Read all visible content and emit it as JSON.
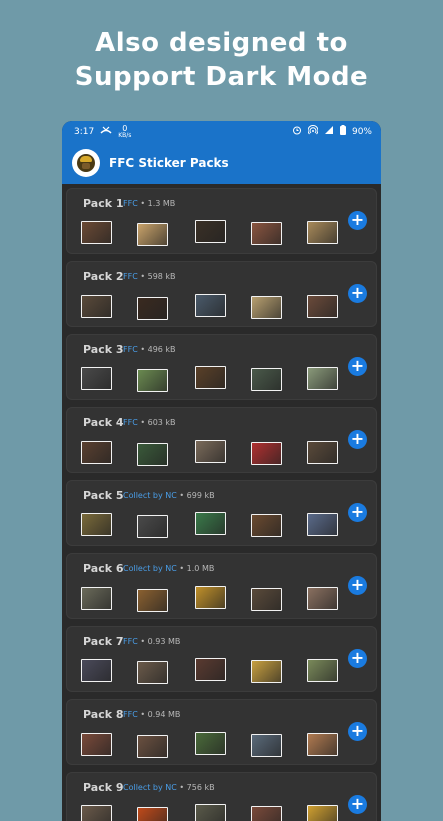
{
  "promo": {
    "line1": "Also designed to",
    "line2": "Support Dark Mode"
  },
  "status": {
    "time": "3:17",
    "speed_top": "0",
    "speed_unit": "KB/s",
    "battery": "90%"
  },
  "app": {
    "title": "FFC Sticker Packs"
  },
  "packs": [
    {
      "name": "Pack 1",
      "publisher": "FFC",
      "size": "1.3 MB"
    },
    {
      "name": "Pack 2",
      "publisher": "FFC",
      "size": "598 kB"
    },
    {
      "name": "Pack 3",
      "publisher": "FFC",
      "size": "496 kB"
    },
    {
      "name": "Pack 4",
      "publisher": "FFC",
      "size": "603 kB"
    },
    {
      "name": "Pack 5",
      "publisher": "Collect by NC",
      "size": "699 kB"
    },
    {
      "name": "Pack 6",
      "publisher": "Collect by NC",
      "size": "1.0 MB"
    },
    {
      "name": "Pack 7",
      "publisher": "FFC",
      "size": "0.93 MB"
    },
    {
      "name": "Pack 8",
      "publisher": "FFC",
      "size": "0.94 MB"
    },
    {
      "name": "Pack 9",
      "publisher": "Collect by NC",
      "size": "756 kB"
    }
  ],
  "add_label": "+",
  "colors": {
    "accent": "#1a73c9",
    "add_button": "#1a7be0",
    "background": "#6f9aa8",
    "card": "#333333"
  }
}
